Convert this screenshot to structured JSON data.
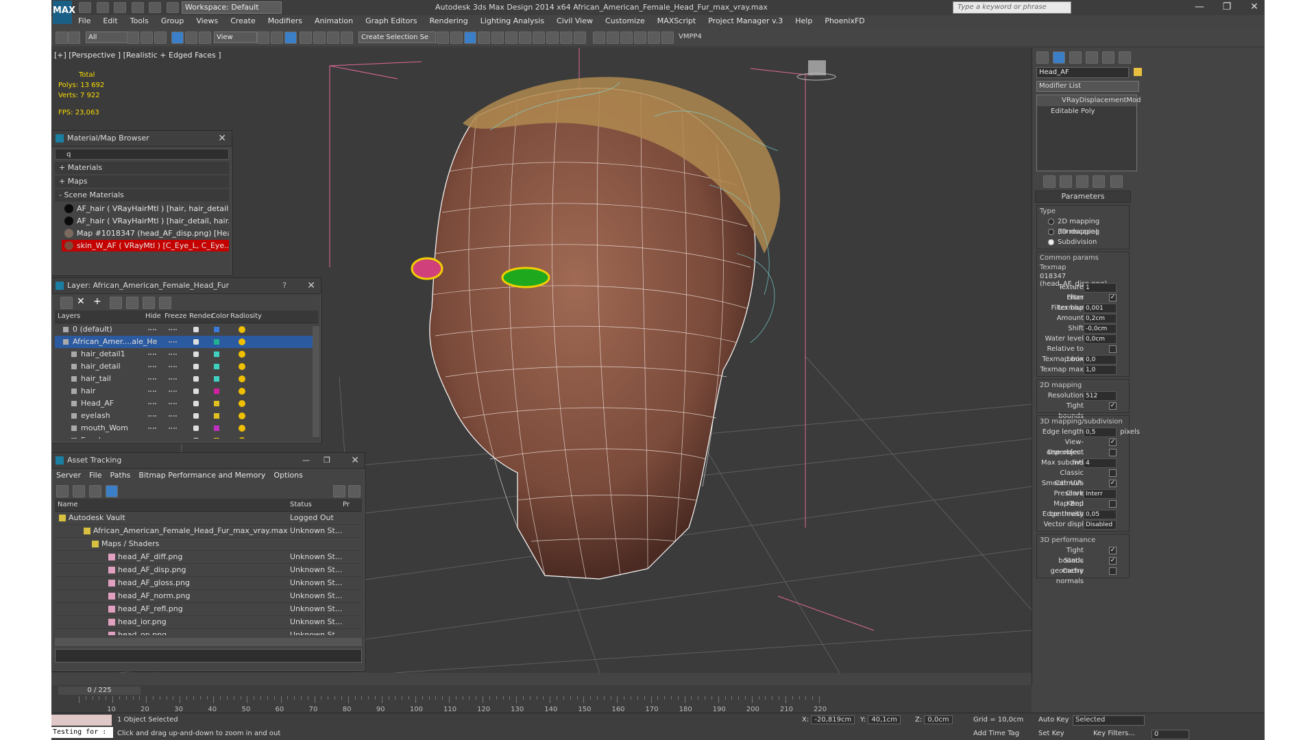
{
  "app": {
    "logo": "MAX",
    "workspace": "Workspace: Default",
    "title": "Autodesk 3ds Max Design 2014 x64     African_American_Female_Head_Fur_max_vray.max",
    "search_placeholder": "Type a keyword or phrase",
    "controls": [
      "—",
      "❐",
      "✕"
    ]
  },
  "menu": [
    "File",
    "Edit",
    "Tools",
    "Group",
    "Views",
    "Create",
    "Modifiers",
    "Animation",
    "Graph Editors",
    "Rendering",
    "Lighting Analysis",
    "Civil View",
    "Customize",
    "MAXScript",
    "Project Manager v.3",
    "Help",
    "PhoenixFD"
  ],
  "toolbar": {
    "filter": "All",
    "ref_coord": "View",
    "selection_set": "Create Selection Se",
    "vmpp": "VMPP4"
  },
  "viewport": {
    "label": "[+] [Perspective ] [Realistic + Edged Faces ]",
    "stats": {
      "total_label": "Total",
      "polys_label": "Polys:",
      "polys": "13 692",
      "verts_label": "Verts:",
      "verts": "7 922",
      "fps_label": "FPS:",
      "fps": "23,063"
    },
    "colors": {
      "skin": "#8a5a48",
      "wire": "#ffffff",
      "hair": "#c8a060",
      "eye_green": "#1ea81e",
      "eye_pink": "#e0407a",
      "grid": "#6a6a6a",
      "helper": "#e06a9a"
    }
  },
  "material_browser": {
    "title": "Material/Map Browser",
    "search_value": "q",
    "sections": [
      "+ Materials",
      "+ Maps",
      "- Scene Materials"
    ],
    "items": [
      {
        "label": "AF_hair  ( VRayHairMtl )  [hair, hair_detail,...",
        "swatch": "#0a0a0a",
        "selected": false
      },
      {
        "label": "AF_hair  ( VRayHairMtl )  [hair_detail, hair...",
        "swatch": "#0a0a0a",
        "selected": false
      },
      {
        "label": "Map #1018347 (head_AF_disp.png)  [Hea...",
        "swatch": "#7a6a60",
        "selected": false
      },
      {
        "label": "skin_W_AF  ( VRayMtl )  [C_Eye_L, C_Eye...",
        "swatch": "#7a4a3a",
        "selected": true
      }
    ]
  },
  "layer_panel": {
    "title": "Layer: African_American_Female_Head_Fur",
    "help": "?",
    "columns": [
      "Layers",
      "Hide",
      "Freeze",
      "Render",
      "Color",
      "Radiosity"
    ],
    "rows": [
      {
        "name": "0 (default)",
        "color": "#3a7ad8",
        "selected": false,
        "indent": 0
      },
      {
        "name": "African_Amer....ale_He",
        "color": "#20b090",
        "selected": true,
        "indent": 0
      },
      {
        "name": "hair_detail1",
        "color": "#40d0c0",
        "selected": false,
        "indent": 1
      },
      {
        "name": "hair_detail",
        "color": "#40d0c0",
        "selected": false,
        "indent": 1
      },
      {
        "name": "hair_tail",
        "color": "#40d0c0",
        "selected": false,
        "indent": 1
      },
      {
        "name": "hair",
        "color": "#d020a0",
        "selected": false,
        "indent": 1
      },
      {
        "name": "Head_AF",
        "color": "#e0c020",
        "selected": false,
        "indent": 1
      },
      {
        "name": "eyelash",
        "color": "#e0c020",
        "selected": false,
        "indent": 1
      },
      {
        "name": "mouth_Wom",
        "color": "#c030c0",
        "selected": false,
        "indent": 1
      },
      {
        "name": "Eye_L",
        "color": "#e0c020",
        "selected": false,
        "indent": 1
      }
    ]
  },
  "asset_tracking": {
    "title": "Asset Tracking",
    "menu": [
      "Server",
      "File",
      "Paths",
      "Bitmap Performance and Memory",
      "Options"
    ],
    "columns": [
      "Name",
      "Status",
      "Pr"
    ],
    "rows": [
      {
        "name": "Autodesk Vault",
        "status": "Logged Out",
        "indent": 20
      },
      {
        "name": "African_American_Female_Head_Fur_max_vray.max",
        "status": "Unknown St...",
        "indent": 56
      },
      {
        "name": "Maps / Shaders",
        "status": "",
        "indent": 68
      },
      {
        "name": "head_AF_diff.png",
        "status": "Unknown St...",
        "indent": 92
      },
      {
        "name": "head_AF_disp.png",
        "status": "Unknown St...",
        "indent": 92
      },
      {
        "name": "head_AF_gloss.png",
        "status": "Unknown St...",
        "indent": 92
      },
      {
        "name": "head_AF_norm.png",
        "status": "Unknown St...",
        "indent": 92
      },
      {
        "name": "head_AF_refl.png",
        "status": "Unknown St...",
        "indent": 92
      },
      {
        "name": "head_ior.png",
        "status": "Unknown St...",
        "indent": 92
      },
      {
        "name": "head_op.png",
        "status": "Unknown St...",
        "indent": 92
      }
    ]
  },
  "command_panel": {
    "object_name": "Head_AF",
    "object_color": "#e8c040",
    "modifier_list": "Modifier List",
    "stack": [
      "VRayDisplacementMod",
      "Editable Poly"
    ],
    "rollout": "Parameters",
    "type_label": "Type",
    "types": [
      {
        "label": "2D mapping (landscape)",
        "on": false
      },
      {
        "label": "3D mapping",
        "on": false
      },
      {
        "label": "Subdivision",
        "on": true
      }
    ],
    "common_label": "Common params",
    "texmap_label": "Texmap",
    "texmap_value": "018347 (head_AF_disp.png)",
    "common": [
      {
        "label": "Texture chan",
        "value": "1",
        "kind": "spin"
      },
      {
        "label": "Filter texmap",
        "value": "✓",
        "kind": "check"
      },
      {
        "label": "Filter blur",
        "value": "0,001",
        "kind": "spin"
      },
      {
        "label": "Amount",
        "value": "0,2cm",
        "kind": "spin"
      },
      {
        "label": "Shift",
        "value": "-0,0cm",
        "kind": "spin"
      },
      {
        "label": "Water level",
        "value": "0,0cm",
        "kind": "spin"
      },
      {
        "label": "Relative to bbox",
        "value": "",
        "kind": "check"
      },
      {
        "label": "Texmap min",
        "value": "0,0",
        "kind": "spin"
      },
      {
        "label": "Texmap max",
        "value": "1,0",
        "kind": "spin"
      }
    ],
    "map2d_label": "2D mapping",
    "map2d": [
      {
        "label": "Resolution",
        "value": "512",
        "kind": "spin"
      },
      {
        "label": "Tight bounds",
        "value": "✓",
        "kind": "check"
      }
    ],
    "map3d_label": "3D mapping/subdivision",
    "map3d": [
      {
        "label": "Edge length",
        "value": "0,5",
        "kind": "spin",
        "suffix": "pixels"
      },
      {
        "label": "View-dependent",
        "value": "✓",
        "kind": "check"
      },
      {
        "label": "Use object mtl",
        "value": "",
        "kind": "check"
      },
      {
        "label": "Max subdivs",
        "value": "4",
        "kind": "spin"
      },
      {
        "label": "Classic Catmull-Clark",
        "value": "",
        "kind": "check"
      },
      {
        "label": "Smooth UVs",
        "value": "✓",
        "kind": "check"
      },
      {
        "label": "Preserve Map Bnd",
        "value": "Interr",
        "kind": "drop"
      },
      {
        "label": "Keep continuity",
        "value": "",
        "kind": "check"
      },
      {
        "label": "Edge thresh",
        "value": "0,05",
        "kind": "spin"
      },
      {
        "label": "Vector displ",
        "value": "Disabled",
        "kind": "drop"
      }
    ],
    "perf_label": "3D performance",
    "perf": [
      {
        "label": "Tight bounds",
        "value": "✓",
        "kind": "check"
      },
      {
        "label": "Static geometry",
        "value": "✓",
        "kind": "check"
      },
      {
        "label": "Cache normals",
        "value": "",
        "kind": "check"
      }
    ]
  },
  "timeline": {
    "frame": "0 / 225",
    "ticks": [
      "10",
      "20",
      "30",
      "40",
      "50",
      "60",
      "70",
      "80",
      "90",
      "100",
      "110",
      "120",
      "130",
      "140",
      "150",
      "160",
      "170",
      "180",
      "190",
      "200",
      "210",
      "220"
    ]
  },
  "status": {
    "script_prompt": "Testing for :",
    "selection": "1 Object Selected",
    "hint": "Click and drag up-and-down to zoom in and out",
    "x_label": "X:",
    "x": "-20,819cm",
    "y_label": "Y:",
    "y": "40,1cm",
    "z_label": "Z:",
    "z": "0,0cm",
    "grid": "Grid = 10,0cm",
    "add_time_tag": "Add Time Tag",
    "auto_key": "Auto Key",
    "set_key": "Set Key",
    "selected": "Selected",
    "key_filters": "Key Filters...",
    "frame_field": "0"
  }
}
